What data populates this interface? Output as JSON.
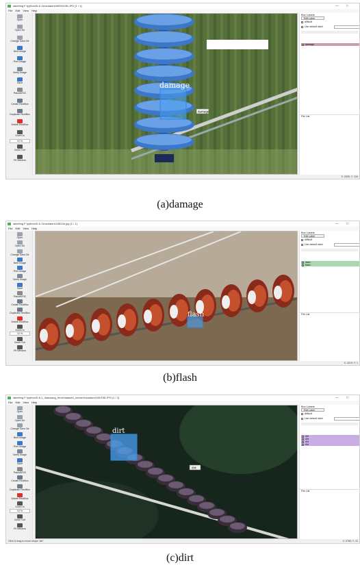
{
  "tools": [
    {
      "label": "Open",
      "icon": "open-folder-icon",
      "color": "#9aa3ad"
    },
    {
      "label": "Open Dir",
      "icon": "open-dir-icon",
      "color": "#9aa3ad"
    },
    {
      "label": "Change Save Dir",
      "icon": "save-dir-icon",
      "color": "#9aa3ad"
    },
    {
      "label": "Next Image",
      "icon": "next-image-icon",
      "color": "#3a78c9"
    },
    {
      "label": "Prev Image",
      "icon": "prev-image-icon",
      "color": "#3a78c9"
    },
    {
      "label": "Verify Image",
      "icon": "verify-icon",
      "color": "#7a8a99"
    },
    {
      "label": "Save",
      "icon": "save-icon",
      "color": "#3a78c9"
    },
    {
      "label": "PascalVOC",
      "icon": "format-icon",
      "color": "#8a8a8a"
    },
    {
      "label": "Create RectBox",
      "icon": "create-box-icon",
      "color": "#6d7a88"
    },
    {
      "label": "Duplicate RectBox",
      "icon": "duplicate-box-icon",
      "color": "#6d7a88"
    },
    {
      "label": "Delete RectBox",
      "icon": "delete-box-icon",
      "color": "#d9322b"
    },
    {
      "label": "Zoom In",
      "icon": "zoom-in-icon",
      "color": "#555555"
    },
    {
      "label": "Zoom Out",
      "icon": "zoom-out-icon",
      "color": "#555555"
    },
    {
      "label": "Fit Window",
      "icon": "fit-window-icon",
      "color": "#555555"
    }
  ],
  "menu": [
    "File",
    "Edit",
    "View",
    "Help"
  ],
  "right_panel": {
    "box_labels_title": "Box Labels",
    "edit_label_button": "Edit Label",
    "difficult": "difficult",
    "use_default_label": "Use default label",
    "file_list_title": "File List"
  },
  "panels": [
    {
      "title": "labelImg F:\\python\\5-6-1\\insulators\\90000138.JPG [1 / 1]",
      "box_label": "damage",
      "popup": "damage",
      "labels": [
        "damage"
      ],
      "label_color": "#c7a0a6",
      "canvas_bg": "#55703a",
      "theme": "damage",
      "status": "",
      "coord": "X: 2000; Y: 134",
      "caption": "(a)damage"
    },
    {
      "title": "labelImg F:\\python\\5-6-1\\insulators\\15810e.jpg [1 / 1]",
      "box_label": "flash",
      "popup": "",
      "labels": [
        "flash",
        "flash"
      ],
      "label_color": "#a9d9b1",
      "canvas_bg": "#8a7560",
      "theme": "flash",
      "status": "",
      "coord": "X: 4219; Y: 1",
      "caption": "(b)flash"
    },
    {
      "title": "labelImg F:\\python\\5-6-1_dianwang_fenxi\\dataset\\_known\\insulators\\160198.JPG [1 / 1]",
      "box_label": "dirt",
      "popup": "dirt",
      "labels": [
        "dirt",
        "dirt",
        "dirt",
        "dirt"
      ],
      "label_color": "#c9aee6",
      "canvas_bg": "#1f2a22",
      "theme": "dirt",
      "status": "Click & drag to move shape 'dirt'",
      "coord": "X: 2783; Y: 12",
      "caption": "(c)dirt"
    }
  ],
  "zoom": "10 %"
}
